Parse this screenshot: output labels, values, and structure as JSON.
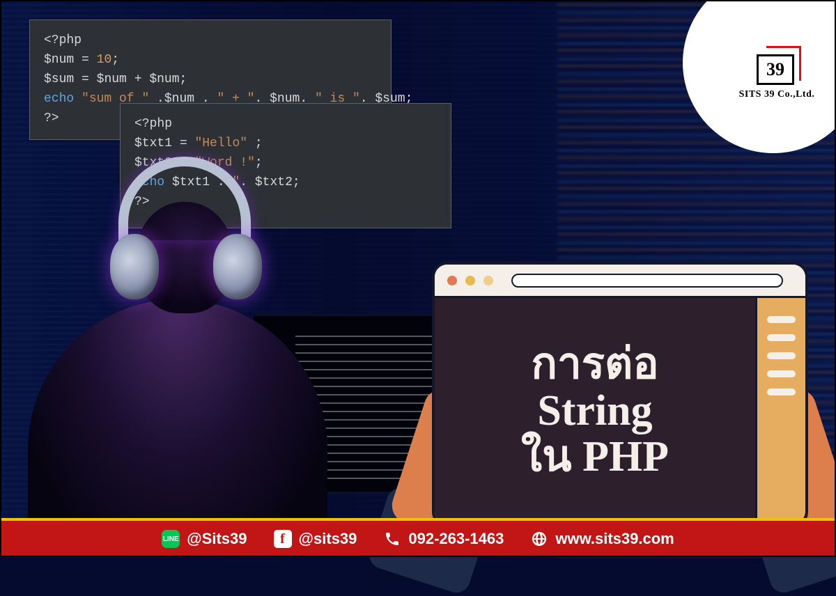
{
  "brand": {
    "number": "39",
    "company": "SITS 39 Co.,Ltd."
  },
  "code_block_1": [
    {
      "kw": "",
      "raw": "<?php"
    },
    {
      "var": "$num",
      "op": " = ",
      "num": "10",
      "end": ";"
    },
    {
      "var": "$sum",
      "op": " = ",
      "v2": "$num",
      "op2": " + ",
      "v3": "$num",
      "end": ";"
    },
    {
      "kw": "echo ",
      "str": "\"sum of \"",
      "p1": " .",
      "v": " $num ",
      "p2": ". ",
      "str2": "\" + \"",
      "p3": ". ",
      "v2": "$num",
      "p4": ". ",
      "str3": "\" is \"",
      "p5": ". ",
      "v3": "$sum",
      "end": ";"
    },
    {
      "raw": "?>"
    }
  ],
  "code_block_2": [
    {
      "raw": "<?php"
    },
    {
      "var": "$txt1",
      "op": " = ",
      "str": "\"Hello\"",
      "end": " ;"
    },
    {
      "var": "$txt2",
      "op": " = ",
      "str": "\"Word !\"",
      "end": ";"
    },
    {
      "kw": "echo ",
      "v": "$txt1 ",
      "p": ".",
      "str": "\"\"",
      "p2": ". ",
      "v2": "$txt2",
      "end": ";"
    },
    {
      "raw": "?>"
    }
  ],
  "card": {
    "title_line1": "การต่อ",
    "title_line2": "String",
    "title_line3": "ใน PHP"
  },
  "footer": {
    "line": "@Sits39",
    "facebook": "@sits39",
    "phone": "092-263-1463",
    "web": "www.sits39.com"
  }
}
